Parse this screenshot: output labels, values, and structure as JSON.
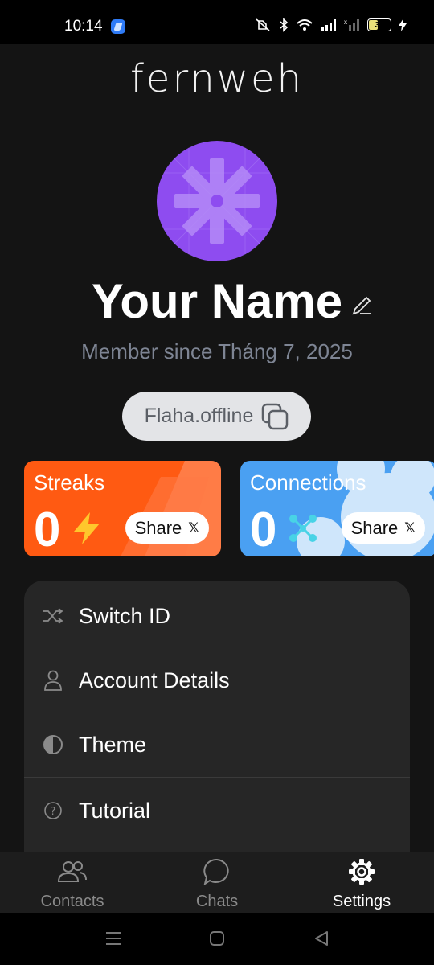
{
  "status_bar": {
    "time": "10:14",
    "battery": "38"
  },
  "app": {
    "logo": "fernweh"
  },
  "profile": {
    "name": "Your Name",
    "member_since": "Member since Tháng 7, 2025",
    "user_id": "Flaha.offline"
  },
  "cards": {
    "streaks": {
      "title": "Streaks",
      "count": "0",
      "share_label": "Share",
      "share_icon": "𝕏",
      "color": "#ff5a12"
    },
    "connections": {
      "title": "Connections",
      "count": "0",
      "share_label": "Share",
      "share_icon": "𝕏",
      "color": "#4aa0f2"
    }
  },
  "menu": {
    "items": [
      {
        "label": "Switch ID",
        "icon": "shuffle-icon"
      },
      {
        "label": "Account Details",
        "icon": "user-icon"
      },
      {
        "label": "Theme",
        "icon": "half-circle-icon"
      },
      {
        "label": "Tutorial",
        "icon": "help-icon"
      }
    ]
  },
  "bottom_nav": {
    "items": [
      {
        "label": "Contacts",
        "icon": "people-icon",
        "active": false
      },
      {
        "label": "Chats",
        "icon": "chat-bubble-icon",
        "active": false
      },
      {
        "label": "Settings",
        "icon": "gear-icon",
        "active": true
      }
    ]
  },
  "colors": {
    "background": "#141414",
    "avatar": "#8e4cf0",
    "menu_bg": "#262626",
    "muted_text": "#7e8594"
  }
}
